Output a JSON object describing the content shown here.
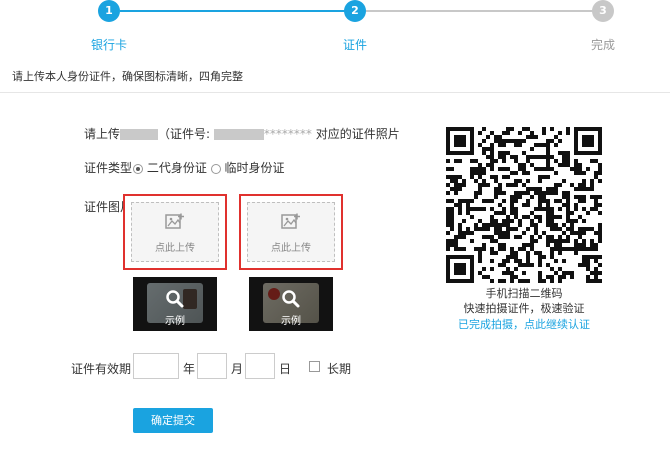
{
  "colors": {
    "accent": "#1aa3e0",
    "inactive": "#c8c8c8",
    "upload_border": "#e0312e",
    "button": "#1aa3e0",
    "link": "#1aa3e0"
  },
  "stepper": {
    "steps": [
      {
        "number": "1",
        "label": "银行卡",
        "state": "done"
      },
      {
        "number": "2",
        "label": "证件",
        "state": "active"
      },
      {
        "number": "3",
        "label": "完成",
        "state": "pending"
      }
    ]
  },
  "notice": "请上传本人身份证件，确保图标清晰，四角完整",
  "form": {
    "prompt_prefix": "请上传",
    "prompt_mid": "（证件号:",
    "prompt_id_partial": "********",
    "prompt_suffix": "对应的证件照片",
    "doc_type_label": "证件类型",
    "doc_type_options": [
      {
        "label": "二代身份证",
        "checked": true
      },
      {
        "label": "临时身份证",
        "checked": false
      }
    ],
    "doc_image_label": "证件图片",
    "upload_text": "点此上传",
    "sample_text": "示例",
    "validity_label": "证件有效期",
    "year_unit": "年",
    "month_unit": "月",
    "day_unit": "日",
    "long_term_label": "长期",
    "submit_label": "确定提交"
  },
  "qr": {
    "caption1": "手机扫描二维码",
    "caption2": "快速拍摄证件，极速验证",
    "link": "已完成拍摄，点此继续认证"
  }
}
